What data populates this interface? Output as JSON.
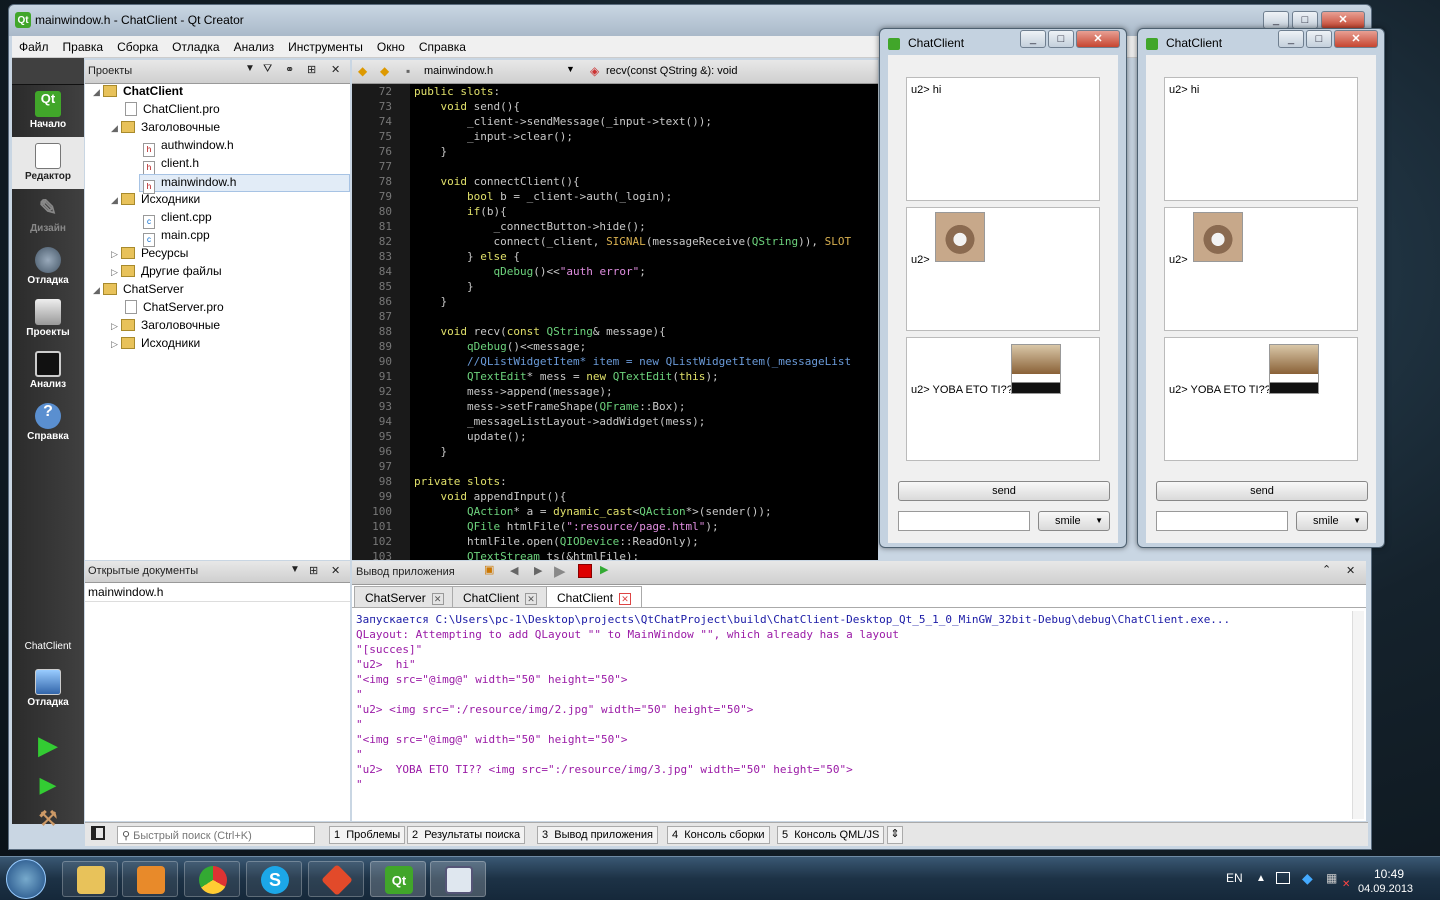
{
  "window": {
    "title": "mainwindow.h - ChatClient - Qt Creator"
  },
  "menu": [
    "Файл",
    "Правка",
    "Сборка",
    "Отладка",
    "Анализ",
    "Инструменты",
    "Окно",
    "Справка"
  ],
  "modes": [
    {
      "label": "Начало"
    },
    {
      "label": "Редактор"
    },
    {
      "label": "Дизайн"
    },
    {
      "label": "Отладка"
    },
    {
      "label": "Проекты"
    },
    {
      "label": "Анализ"
    },
    {
      "label": "Справка"
    }
  ],
  "run_target": {
    "name": "ChatClient",
    "mode": "Отладка"
  },
  "projects": {
    "header": "Проекты",
    "tree": [
      {
        "label": "ChatClient",
        "level": 0,
        "kind": "project",
        "bold": true
      },
      {
        "label": "ChatClient.pro",
        "level": 1,
        "kind": "file"
      },
      {
        "label": "Заголовочные",
        "level": 1,
        "kind": "folder"
      },
      {
        "label": "authwindow.h",
        "level": 2,
        "kind": "h"
      },
      {
        "label": "client.h",
        "level": 2,
        "kind": "h"
      },
      {
        "label": "mainwindow.h",
        "level": 2,
        "kind": "h",
        "selected": true
      },
      {
        "label": "Исходники",
        "level": 1,
        "kind": "folder"
      },
      {
        "label": "client.cpp",
        "level": 2,
        "kind": "cpp"
      },
      {
        "label": "main.cpp",
        "level": 2,
        "kind": "cpp"
      },
      {
        "label": "Ресурсы",
        "level": 1,
        "kind": "folder"
      },
      {
        "label": "Другие файлы",
        "level": 1,
        "kind": "folder"
      },
      {
        "label": "ChatServer",
        "level": 0,
        "kind": "project"
      },
      {
        "label": "ChatServer.pro",
        "level": 1,
        "kind": "file"
      },
      {
        "label": "Заголовочные",
        "level": 1,
        "kind": "folder"
      },
      {
        "label": "Исходники",
        "level": 1,
        "kind": "folder"
      }
    ]
  },
  "editor": {
    "file": "mainwindow.h",
    "symbol": "recv(const QString &): void",
    "lines": [
      {
        "n": "72",
        "t": "public slots:"
      },
      {
        "n": "73",
        "t": "    void send(){"
      },
      {
        "n": "74",
        "t": "        _client->sendMessage(_input->text());"
      },
      {
        "n": "75",
        "t": "        _input->clear();"
      },
      {
        "n": "76",
        "t": "    }"
      },
      {
        "n": "77",
        "t": ""
      },
      {
        "n": "78",
        "t": "    void connectClient(){"
      },
      {
        "n": "79",
        "t": "        bool b = _client->auth(_login);"
      },
      {
        "n": "80",
        "t": "        if(b){"
      },
      {
        "n": "81",
        "t": "            _connectButton->hide();"
      },
      {
        "n": "82",
        "t": "            connect(_client, SIGNAL(messageReceive(QString)), SLOT"
      },
      {
        "n": "83",
        "t": "        } else {"
      },
      {
        "n": "84",
        "t": "            qDebug()<<\"auth error\";"
      },
      {
        "n": "85",
        "t": "        }"
      },
      {
        "n": "86",
        "t": "    }"
      },
      {
        "n": "87",
        "t": ""
      },
      {
        "n": "88",
        "t": "    void recv(const QString& message){"
      },
      {
        "n": "89",
        "t": "        qDebug()<<message;"
      },
      {
        "n": "90",
        "t": "        //QListWidgetItem* item = new QListWidgetItem(_messageList"
      },
      {
        "n": "91",
        "t": "        QTextEdit* mess = new QTextEdit(this);"
      },
      {
        "n": "92",
        "t": "        mess->append(message);"
      },
      {
        "n": "93",
        "t": "        mess->setFrameShape(QFrame::Box);"
      },
      {
        "n": "94",
        "t": "        _messageListLayout->addWidget(mess);"
      },
      {
        "n": "95",
        "t": "        update();"
      },
      {
        "n": "96",
        "t": "    }"
      },
      {
        "n": "97",
        "t": ""
      },
      {
        "n": "98",
        "t": "private slots:"
      },
      {
        "n": "99",
        "t": "    void appendInput(){"
      },
      {
        "n": "100",
        "t": "        QAction* a = dynamic_cast<QAction*>(sender());"
      },
      {
        "n": "101",
        "t": "        QFile htmlFile(\":resource/page.html\");"
      },
      {
        "n": "102",
        "t": "        htmlFile.open(QIODevice::ReadOnly);"
      },
      {
        "n": "103",
        "t": "        QTextStream ts(&htmlFile);"
      }
    ]
  },
  "open_docs": {
    "header": "Открытые документы",
    "items": [
      "mainwindow.h"
    ]
  },
  "output": {
    "header": "Вывод приложения",
    "tabs": [
      "ChatServer",
      "ChatClient",
      "ChatClient"
    ],
    "lines": [
      {
        "t": "Запускается C:\\Users\\pc-1\\Desktop\\projects\\QtChatProject\\build\\ChatClient-Desktop_Qt_5_1_0_MinGW_32bit-Debug\\debug\\ChatClient.exe...",
        "c": "#1a1aa6"
      },
      {
        "t": "QLayout: Attempting to add QLayout \"\" to MainWindow \"\", which already has a layout",
        "c": "#9a1aa6"
      },
      {
        "t": "\"[succes]\"",
        "c": "#9a1aa6"
      },
      {
        "t": "\"u2>  hi\"",
        "c": "#9a1aa6"
      },
      {
        "t": "\"<img src=\"@img@\" width=\"50\" height=\"50\">",
        "c": "#9a1aa6"
      },
      {
        "t": "\"",
        "c": "#9a1aa6"
      },
      {
        "t": "\"u2> <img src=\":/resource/img/2.jpg\" width=\"50\" height=\"50\">",
        "c": "#9a1aa6"
      },
      {
        "t": "\"",
        "c": "#9a1aa6"
      },
      {
        "t": "\"<img src=\"@img@\" width=\"50\" height=\"50\">",
        "c": "#9a1aa6"
      },
      {
        "t": "\"",
        "c": "#9a1aa6"
      },
      {
        "t": "\"u2>  YOBA ETO TI?? <img src=\":/resource/img/3.jpg\" width=\"50\" height=\"50\">",
        "c": "#9a1aa6"
      },
      {
        "t": "\"",
        "c": "#9a1aa6"
      }
    ]
  },
  "statusbar": {
    "search_placeholder": "Быстрый поиск (Ctrl+K)",
    "panes": [
      {
        "n": "1",
        "l": "Проблемы"
      },
      {
        "n": "2",
        "l": "Результаты поиска"
      },
      {
        "n": "3",
        "l": "Вывод приложения"
      },
      {
        "n": "4",
        "l": "Консоль сборки"
      },
      {
        "n": "5",
        "l": "Консоль QML/JS"
      }
    ]
  },
  "chat": {
    "title": "ChatClient",
    "msg1": "u2> hi",
    "msg2": "u2>",
    "msg3": "u2> YOBA ETO TI??",
    "send": "send",
    "smile": "smile"
  },
  "taskbar": {
    "lang": "EN",
    "time": "10:49",
    "date": "04.09.2013"
  }
}
